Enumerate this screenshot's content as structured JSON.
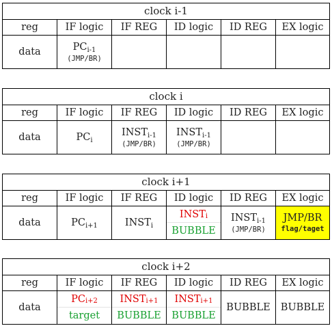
{
  "headers": [
    "reg",
    "IF logic",
    "IF REG",
    "ID logic",
    "ID REG",
    "EX logic"
  ],
  "row_label": "data",
  "blocks": [
    {
      "title": "clock i-1",
      "cells": {
        "if_logic": {
          "main": "PC",
          "sub": "i-1",
          "note": "(JMP/BR)"
        }
      }
    },
    {
      "title": "clock i",
      "cells": {
        "if_logic": {
          "main": "PC",
          "sub": "i"
        },
        "if_reg": {
          "main": "INST",
          "sub": "i-1",
          "note": "(JMP/BR)"
        },
        "id_logic": {
          "main": "INST",
          "sub": "i-1",
          "note": "(JMP/BR)"
        }
      }
    },
    {
      "title": "clock i+1",
      "cells": {
        "if_logic": {
          "main": "PC",
          "sub": "i+1"
        },
        "if_reg": {
          "main": "INST",
          "sub": "i"
        },
        "id_logic": {
          "main": "INST",
          "sub": "i",
          "lower": "BUBBLE"
        },
        "id_reg": {
          "main": "INST",
          "sub": "i-1",
          "note": "(JMP/BR)"
        },
        "ex_logic": {
          "main": "JMP/BR",
          "note": "flag/taget"
        }
      }
    },
    {
      "title": "clock i+2",
      "cells": {
        "if_logic": {
          "main": "PC",
          "sub": "i+2",
          "lower": "target"
        },
        "if_reg": {
          "main": "INST",
          "sub": "i+1",
          "lower": "BUBBLE"
        },
        "id_logic": {
          "main": "INST",
          "sub": "i+1",
          "lower": "BUBBLE"
        },
        "id_reg": {
          "main": "BUBBLE"
        },
        "ex_logic": {
          "main": "BUBBLE"
        }
      }
    }
  ],
  "colors": {
    "red": "#e00000",
    "green": "#18a030",
    "highlight": "#ffff00"
  }
}
